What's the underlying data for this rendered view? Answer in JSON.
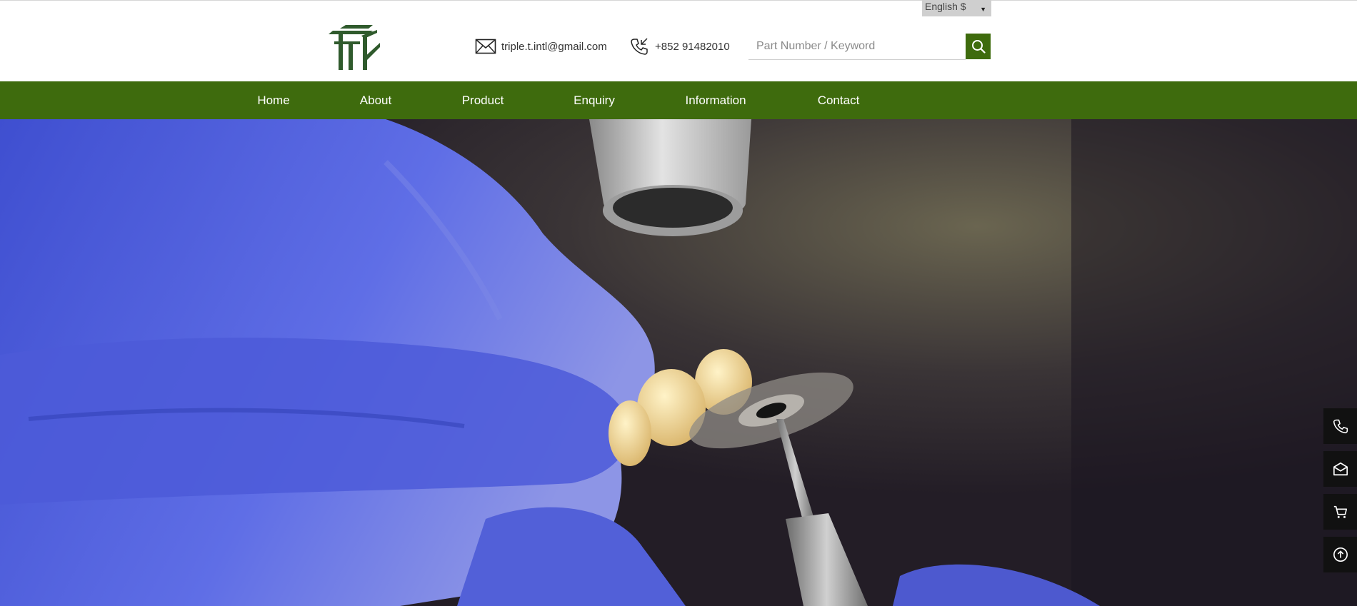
{
  "language": {
    "selected": "English $"
  },
  "header": {
    "email": "triple.t.intl@gmail.com",
    "phone": "+852 91482010",
    "search_placeholder": "Part Number / Keyword"
  },
  "nav": {
    "items": [
      {
        "label": "Home"
      },
      {
        "label": "About"
      },
      {
        "label": "Product"
      },
      {
        "label": "Enquiry"
      },
      {
        "label": "Information"
      },
      {
        "label": "Contact"
      }
    ]
  },
  "side_buttons": [
    "phone-icon",
    "mail-icon",
    "cart-icon",
    "back-to-top-icon"
  ],
  "colors": {
    "brand_green": "#3e6b0d",
    "logo_green": "#2f5a2c",
    "side_bar": "#111111",
    "lang_bg": "#cfcfcf"
  }
}
